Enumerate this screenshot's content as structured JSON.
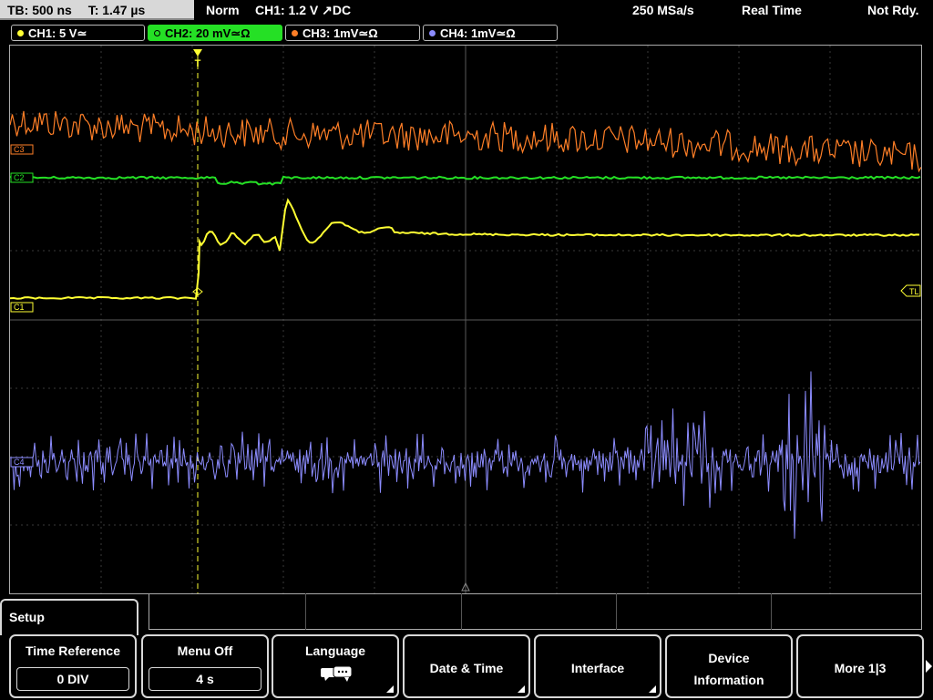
{
  "status": {
    "timebase": "TB: 500 ns",
    "trigger_time": "T: 1.47 µs",
    "mode": "Norm",
    "trigger_info": "CH1: 1.2 V ↗DC",
    "sample_rate": "250 MSa/s",
    "acquisition": "Real Time",
    "state": "Not Rdy."
  },
  "channels": [
    {
      "label": "CH1: 5 V≃",
      "color": "#ffff33",
      "active": false
    },
    {
      "label": "CH2: 20 mV≃Ω",
      "color": "#25e025",
      "active": true
    },
    {
      "label": "CH3: 1mV≃Ω",
      "color": "#ff7f27",
      "active": false
    },
    {
      "label": "CH4: 1mV≃Ω",
      "color": "#8c8cff",
      "active": false
    }
  ],
  "markers": {
    "c3": "C3",
    "c2": "C2",
    "c1": "C1",
    "c4": "C4",
    "trigger_level": "TL",
    "trigger_pos": "T"
  },
  "menu": {
    "title": "Setup",
    "softkeys": [
      {
        "label": "Time Reference",
        "value": "0 DIV"
      },
      {
        "label": "Menu Off",
        "value": "4 s"
      },
      {
        "label": "Language",
        "icon": "speech-bubbles-icon"
      },
      {
        "label": "Date & Time"
      },
      {
        "label": "Interface"
      },
      {
        "label": "Device",
        "label2": "Information"
      },
      {
        "label": "More 1|3"
      }
    ]
  }
}
